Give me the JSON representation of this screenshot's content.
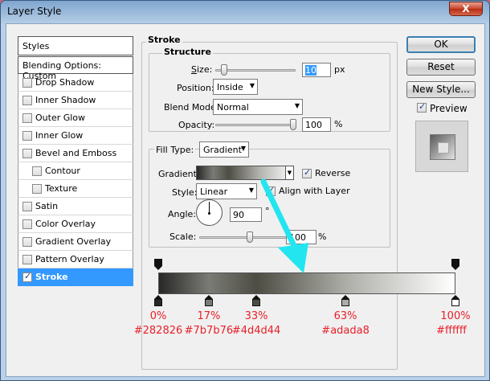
{
  "window": {
    "title": "Layer Style",
    "close_label": "X"
  },
  "styles_panel": {
    "header": "Styles",
    "blending": "Blending Options: Custom",
    "items": [
      {
        "label": "Drop Shadow",
        "checked": false,
        "indent": false,
        "active": false
      },
      {
        "label": "Inner Shadow",
        "checked": false,
        "indent": false,
        "active": false
      },
      {
        "label": "Outer Glow",
        "checked": false,
        "indent": false,
        "active": false
      },
      {
        "label": "Inner Glow",
        "checked": false,
        "indent": false,
        "active": false
      },
      {
        "label": "Bevel and Emboss",
        "checked": false,
        "indent": false,
        "active": false
      },
      {
        "label": "Contour",
        "checked": false,
        "indent": true,
        "active": false
      },
      {
        "label": "Texture",
        "checked": false,
        "indent": true,
        "active": false
      },
      {
        "label": "Satin",
        "checked": false,
        "indent": false,
        "active": false
      },
      {
        "label": "Color Overlay",
        "checked": false,
        "indent": false,
        "active": false
      },
      {
        "label": "Gradient Overlay",
        "checked": false,
        "indent": false,
        "active": false
      },
      {
        "label": "Pattern Overlay",
        "checked": false,
        "indent": false,
        "active": false
      },
      {
        "label": "Stroke",
        "checked": true,
        "indent": false,
        "active": true
      }
    ]
  },
  "stroke": {
    "group_title": "Stroke",
    "structure_title": "Structure",
    "size_label": "Size:",
    "size_value": "10",
    "size_unit": "px",
    "position_label": "Position:",
    "position_value": "Inside",
    "blend_mode_label": "Blend Mode:",
    "blend_mode_value": "Normal",
    "opacity_label": "Opacity:",
    "opacity_value": "100",
    "opacity_unit": "%",
    "fill_type_label": "Fill Type:",
    "fill_type_value": "Gradient",
    "gradient_label": "Gradient:",
    "reverse_label": "Reverse",
    "style_label": "Style:",
    "style_value": "Linear",
    "align_label": "Align with Layer",
    "angle_label": "Angle:",
    "angle_value": "90",
    "angle_unit": "°",
    "scale_label": "Scale:",
    "scale_value": "100",
    "scale_unit": "%"
  },
  "buttons": {
    "ok": "OK",
    "reset": "Reset",
    "new_style": "New Style...",
    "preview": "Preview"
  },
  "gradient_stops": [
    {
      "pct": "0%",
      "hex": "#282826",
      "pos": 0
    },
    {
      "pct": "17%",
      "hex": "#7b7b76",
      "pos": 0.17
    },
    {
      "pct": "33%",
      "hex": "#4d4d44",
      "pos": 0.33
    },
    {
      "pct": "63%",
      "hex": "#adada8",
      "pos": 0.63
    },
    {
      "pct": "100%",
      "hex": "#ffffff",
      "pos": 1
    }
  ],
  "colors": {
    "accent": "#3399ff",
    "annotation": "#e8202a",
    "arrow": "#22e5f0"
  }
}
